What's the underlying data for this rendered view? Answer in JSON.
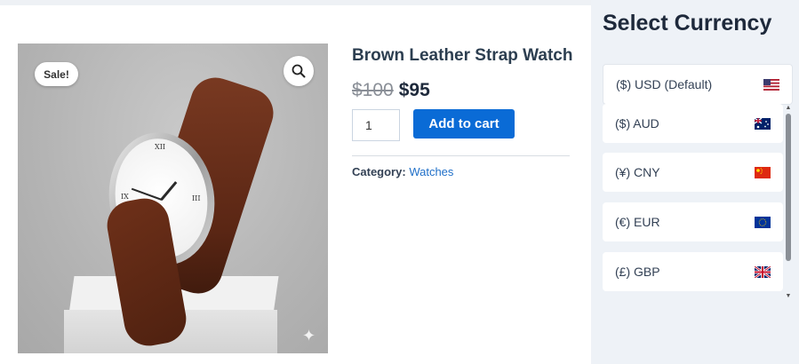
{
  "product": {
    "sale_badge": "Sale!",
    "title": "Brown Leather Strap Watch",
    "price_old": "$100",
    "price_new": "$95",
    "quantity": "1",
    "add_to_cart_label": "Add to cart",
    "category_label": "Category:",
    "category_value": "Watches",
    "icons": {
      "zoom": "search-icon",
      "sparkle": "sparkle-icon"
    }
  },
  "currency": {
    "heading": "Select Currency",
    "options": [
      {
        "label": "($) USD (Default)",
        "flag": "us-flag-icon"
      },
      {
        "label": "($) AUD",
        "flag": "au-flag-icon"
      },
      {
        "label": "(¥) CNY",
        "flag": "cn-flag-icon"
      },
      {
        "label": "(€) EUR",
        "flag": "eu-flag-icon"
      },
      {
        "label": "(£) GBP",
        "flag": "gb-flag-icon"
      }
    ]
  },
  "colors": {
    "accent": "#0a6bd6",
    "link": "#1f6fc8",
    "panel_bg": "#eef2f7"
  }
}
